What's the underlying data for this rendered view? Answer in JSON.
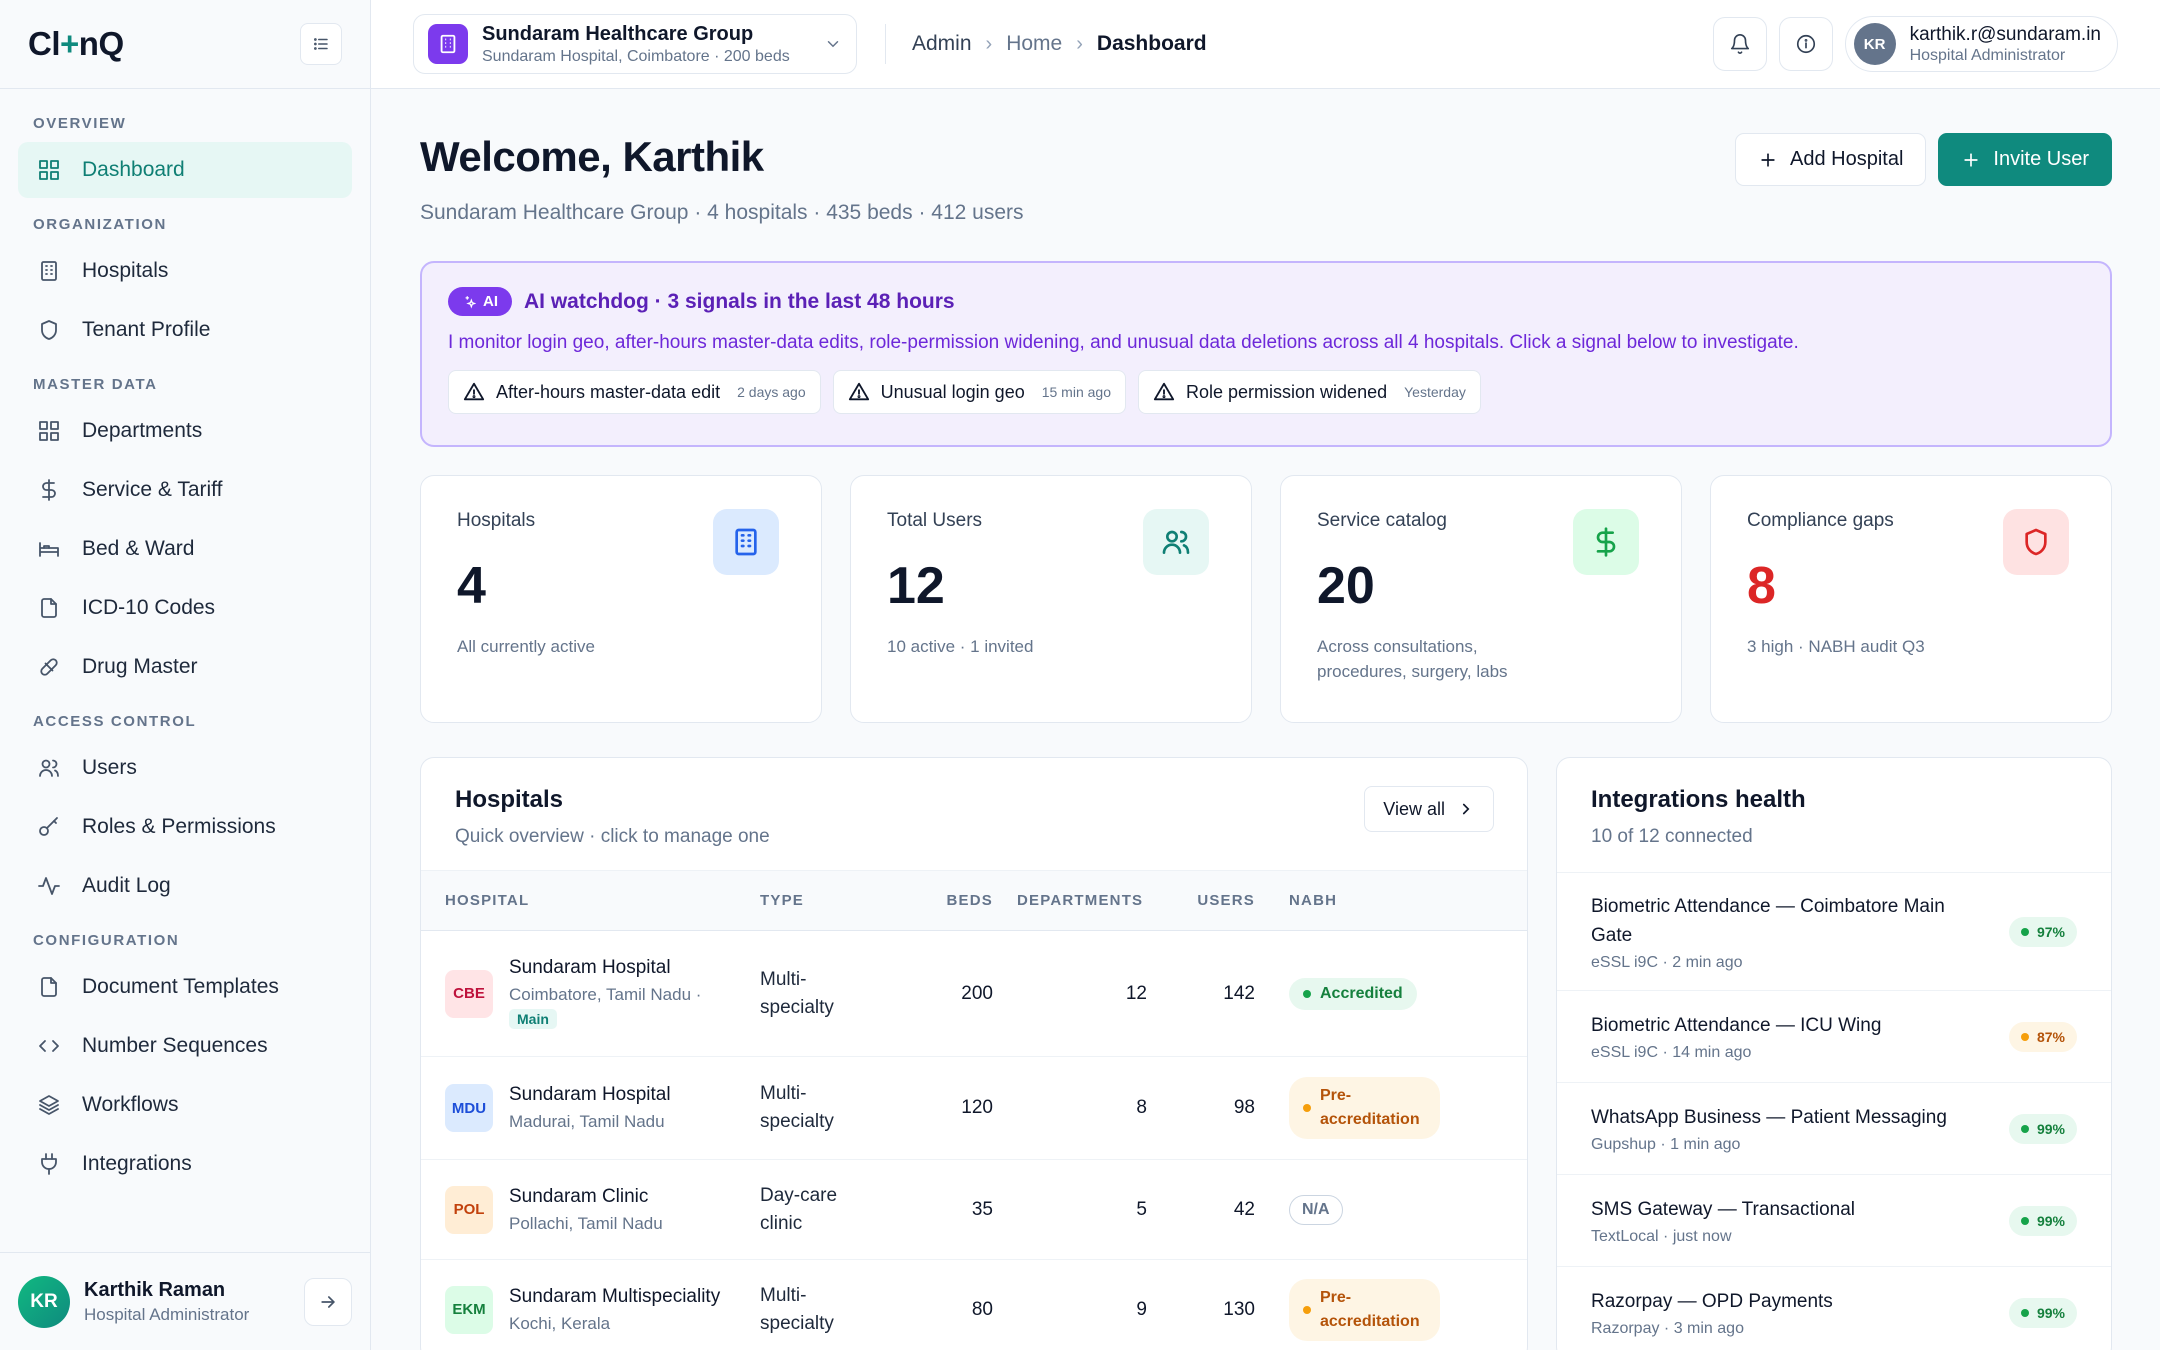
{
  "brand": {
    "logo_left": "Cl",
    "logo_plus": "+",
    "logo_right": "nQ"
  },
  "sidebar": {
    "sections": [
      {
        "title": "OVERVIEW",
        "items": [
          {
            "label": "Dashboard",
            "icon": "dashboard-grid-icon",
            "active": true
          }
        ]
      },
      {
        "title": "ORGANIZATION",
        "items": [
          {
            "label": "Hospitals",
            "icon": "building-icon"
          },
          {
            "label": "Tenant Profile",
            "icon": "shield-icon"
          }
        ]
      },
      {
        "title": "MASTER DATA",
        "items": [
          {
            "label": "Departments",
            "icon": "grid-icon"
          },
          {
            "label": "Service & Tariff",
            "icon": "dollar-icon"
          },
          {
            "label": "Bed & Ward",
            "icon": "bed-icon"
          },
          {
            "label": "ICD-10 Codes",
            "icon": "file-icon"
          },
          {
            "label": "Drug Master",
            "icon": "pill-icon"
          }
        ]
      },
      {
        "title": "ACCESS CONTROL",
        "items": [
          {
            "label": "Users",
            "icon": "users-icon"
          },
          {
            "label": "Roles & Permissions",
            "icon": "key-icon"
          },
          {
            "label": "Audit Log",
            "icon": "activity-icon"
          }
        ]
      },
      {
        "title": "CONFIGURATION",
        "items": [
          {
            "label": "Document Templates",
            "icon": "document-icon"
          },
          {
            "label": "Number Sequences",
            "icon": "code-icon"
          },
          {
            "label": "Workflows",
            "icon": "layers-icon"
          },
          {
            "label": "Integrations",
            "icon": "plug-icon"
          }
        ]
      }
    ],
    "footer": {
      "initials": "KR",
      "name": "Karthik Raman",
      "role": "Hospital Administrator"
    }
  },
  "header": {
    "org": {
      "name": "Sundaram Healthcare Group",
      "sub": "Sundaram Hospital, Coimbatore · 200 beds"
    },
    "breadcrumb": {
      "admin": "Admin",
      "home": "Home",
      "current": "Dashboard",
      "sep": "›"
    },
    "user": {
      "initials": "KR",
      "email": "karthik.r@sundaram.in",
      "role": "Hospital Administrator"
    }
  },
  "welcome": {
    "title": "Welcome, Karthik",
    "subtitle": "Sundaram Healthcare Group · 4 hospitals · 435 beds · 412 users",
    "add_hospital": "Add Hospital",
    "invite_user": "Invite User"
  },
  "ai": {
    "badge": "AI",
    "title": "AI watchdog · 3 signals in the last 48 hours",
    "description": "I monitor login geo, after-hours master-data edits, role-permission widening, and unusual data deletions across all 4 hospitals. Click a signal below to investigate.",
    "signals": [
      {
        "label": "After-hours master-data edit",
        "time": "2 days ago"
      },
      {
        "label": "Unusual login geo",
        "time": "15 min ago"
      },
      {
        "label": "Role permission widened",
        "time": "Yesterday"
      }
    ]
  },
  "stats": [
    {
      "label": "Hospitals",
      "value": "4",
      "note": "All currently active",
      "icon": "building-icon",
      "color": "#2563eb",
      "bg": "#dbeafe"
    },
    {
      "label": "Total Users",
      "value": "12",
      "note": "10 active · 1 invited",
      "icon": "users-icon",
      "color": "#0f7f74",
      "bg": "#e6f7f4"
    },
    {
      "label": "Service catalog",
      "value": "20",
      "note": "Across consultations, procedures, surgery, labs",
      "icon": "dollar-icon",
      "color": "#16a34a",
      "bg": "#dcfce7"
    },
    {
      "label": "Compliance gaps",
      "value": "8",
      "note": "3 high · NABH audit Q3",
      "icon": "shield-icon",
      "color": "#dc2626",
      "bg": "#fee2e2"
    }
  ],
  "hospitals_panel": {
    "title": "Hospitals",
    "subtitle": "Quick overview · click to manage one",
    "view_all": "View all",
    "columns": [
      "HOSPITAL",
      "TYPE",
      "BEDS",
      "DEPARTMENTS",
      "USERS",
      "NABH"
    ],
    "rows": [
      {
        "code": "CBE",
        "code_color": "#be123c",
        "code_bg": "#ffe4e6",
        "name": "Sundaram Hospital",
        "location": "Coimbatore, Tamil Nadu ·",
        "tag": "Main",
        "type": "Multi-specialty",
        "beds": "200",
        "departments": "12",
        "users": "142",
        "nabh": "Accredited",
        "nabh_status": "green"
      },
      {
        "code": "MDU",
        "code_color": "#1d4ed8",
        "code_bg": "#dbeafe",
        "name": "Sundaram Hospital",
        "location": "Madurai, Tamil Nadu",
        "tag": "",
        "type": "Multi-specialty",
        "beds": "120",
        "departments": "8",
        "users": "98",
        "nabh": "Pre-accreditation",
        "nabh_status": "amber"
      },
      {
        "code": "POL",
        "code_color": "#c2410c",
        "code_bg": "#ffedd5",
        "name": "Sundaram Clinic",
        "location": "Pollachi, Tamil Nadu",
        "tag": "",
        "type": "Day-care clinic",
        "beds": "35",
        "departments": "5",
        "users": "42",
        "nabh": "N/A",
        "nabh_status": "gray"
      },
      {
        "code": "EKM",
        "code_color": "#15803d",
        "code_bg": "#dcfce7",
        "name": "Sundaram Multispeciality",
        "location": "Kochi, Kerala",
        "tag": "",
        "type": "Multi-specialty",
        "beds": "80",
        "departments": "9",
        "users": "130",
        "nabh": "Pre-accreditation",
        "nabh_status": "amber"
      }
    ]
  },
  "integrations_panel": {
    "title": "Integrations health",
    "subtitle": "10 of 12 connected",
    "items": [
      {
        "name": "Biometric Attendance — Coimbatore Main Gate",
        "meta": "eSSL i9C · 2 min ago",
        "pct": "97%",
        "status": "green"
      },
      {
        "name": "Biometric Attendance — ICU Wing",
        "meta": "eSSL i9C · 14 min ago",
        "pct": "87%",
        "status": "amber"
      },
      {
        "name": "WhatsApp Business — Patient Messaging",
        "meta": "Gupshup · 1 min ago",
        "pct": "99%",
        "status": "green"
      },
      {
        "name": "SMS Gateway — Transactional",
        "meta": "TextLocal · just now",
        "pct": "99%",
        "status": "green"
      },
      {
        "name": "Razorpay — OPD Payments",
        "meta": "Razorpay · 3 min ago",
        "pct": "99%",
        "status": "green"
      }
    ]
  }
}
